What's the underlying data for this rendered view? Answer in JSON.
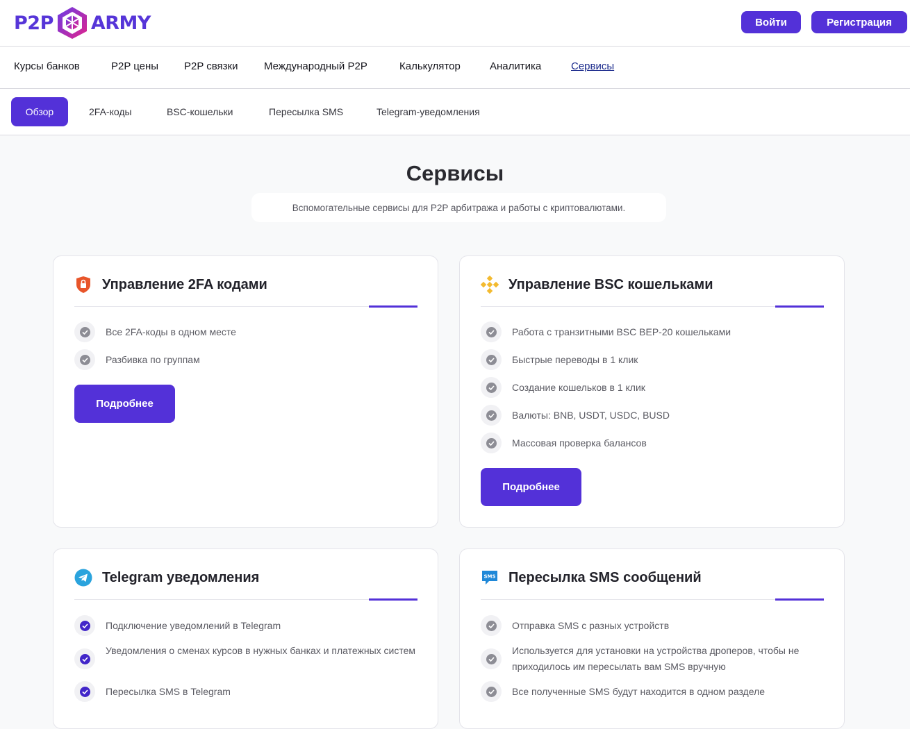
{
  "header": {
    "logo_left": "P2P",
    "logo_right": "ARMY",
    "login_label": "Войти",
    "register_label": "Регистрация"
  },
  "mainnav": {
    "items": [
      "Курсы банков",
      "P2P цены",
      "P2P связки",
      "Международный P2P",
      "Калькулятор",
      "Аналитика",
      "Сервисы"
    ],
    "active": "Сервисы"
  },
  "subnav": {
    "items": [
      "Обзор",
      "2FA-коды",
      "BSC-кошельки",
      "Пересылка SMS",
      "Telegram-уведомления"
    ],
    "active": "Обзор"
  },
  "page": {
    "title": "Сервисы",
    "subtitle": "Вспомогательные сервисы для P2P арбитража и работы с криптовалютами."
  },
  "cards": [
    {
      "title": "Управление 2FA кодами",
      "icon": "shield-lock-icon",
      "features": [
        "Все 2FA-коды в одном месте",
        "Разбивка по группам"
      ],
      "button_label": "Подробнее"
    },
    {
      "title": "Управление BSC кошельками",
      "icon": "bnb-icon",
      "features": [
        "Работа с транзитными BSC BEP-20 кошельками",
        "Быстрые переводы в 1 клик",
        "Создание кошельков в 1 клик",
        "Валюты: BNB, USDT, USDC, BUSD",
        "Массовая проверка балансов"
      ],
      "button_label": "Подробнее"
    },
    {
      "title": "Telegram уведомления",
      "icon": "telegram-icon",
      "features": [
        "Подключение уведомлений в Telegram",
        "Уведомления о сменах курсов в нужных банках и платежных систем",
        "Пересылка SMS в Telegram"
      ]
    },
    {
      "title": "Пересылка SMS сообщений",
      "icon": "sms-icon",
      "features": [
        "Отправка SMS с разных устройств",
        "Используется для установки на устройства дроперов, чтобы не приходилось им пересылать вам SMS вручную",
        "Все полученные SMS будут находится в одном разделе"
      ]
    }
  ],
  "colors": {
    "accent": "#5331d8",
    "background": "#f8f9fa",
    "bnb": "#f3ba2f",
    "telegram": "#2aa3dd",
    "shield": "#e8552a"
  }
}
